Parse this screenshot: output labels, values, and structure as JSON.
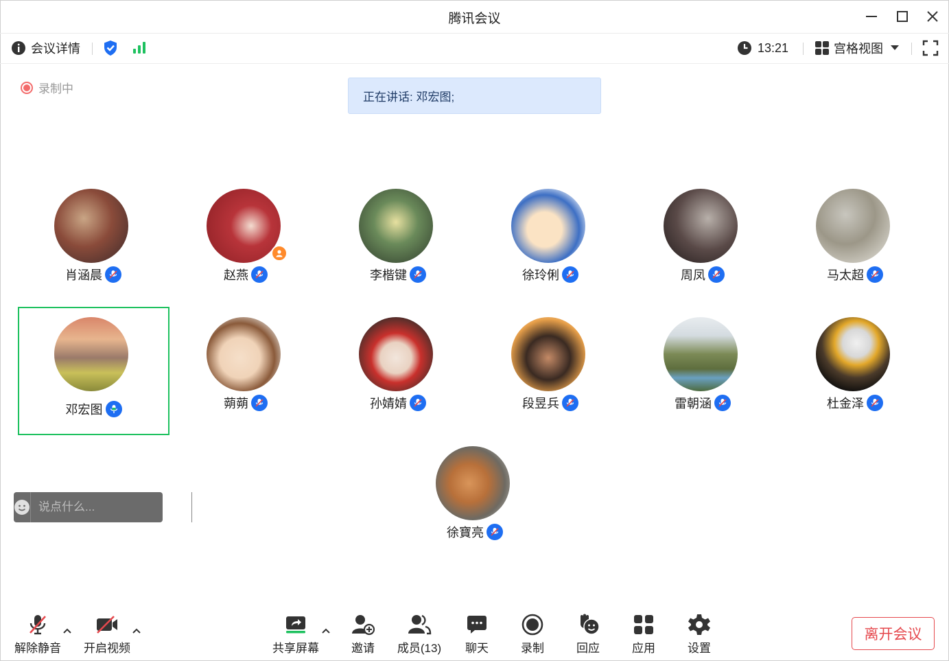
{
  "window": {
    "title": "腾讯会议"
  },
  "infobar": {
    "meeting_details": "会议详情",
    "time": "13:21",
    "view_mode": "宫格视图"
  },
  "recording_status": "录制中",
  "speaking_banner": "正在讲话: 邓宏图;",
  "participants": [
    {
      "name": "肖涵晨"
    },
    {
      "name": "赵燕"
    },
    {
      "name": "李楷键"
    },
    {
      "name": "徐玲俐"
    },
    {
      "name": "周凤"
    },
    {
      "name": "马太超"
    },
    {
      "name": "邓宏图"
    },
    {
      "name": "蒴蒴"
    },
    {
      "name": "孙婧婧"
    },
    {
      "name": "段昱兵"
    },
    {
      "name": "雷朝涵"
    },
    {
      "name": "杜金泽"
    },
    {
      "name": "徐寶亮"
    }
  ],
  "chat": {
    "placeholder": "说点什么..."
  },
  "toolbar": {
    "unmute": "解除静音",
    "start_video": "开启视频",
    "share_screen": "共享屏幕",
    "invite": "邀请",
    "members": "成员(13)",
    "chat": "聊天",
    "record": "录制",
    "reactions": "回应",
    "apps": "应用",
    "settings": "设置",
    "leave": "离开会议"
  },
  "colors": {
    "accent_blue": "#1e6ef2",
    "active_speaker_border": "#1ec15f",
    "leave_red": "#e5484d",
    "signal_green": "#1ec15f",
    "speaking_banner_bg": "#dce9fd"
  }
}
